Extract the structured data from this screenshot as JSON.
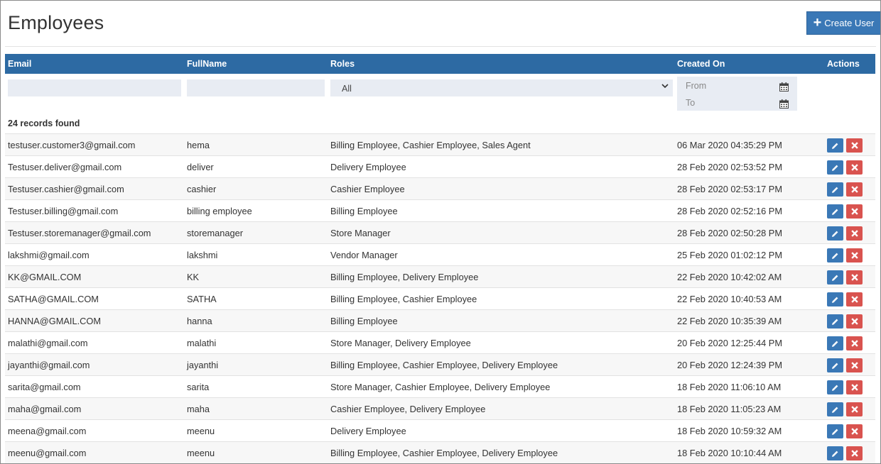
{
  "header": {
    "title": "Employees",
    "create_label": "Create User",
    "create_icon": "plus-icon"
  },
  "columns": {
    "email": "Email",
    "fullname": "FullName",
    "roles": "Roles",
    "created_on": "Created On",
    "actions": "Actions"
  },
  "filters": {
    "email_value": "",
    "fullname_value": "",
    "roles_selected": "All",
    "from_placeholder": "From",
    "to_placeholder": "To"
  },
  "records_found": "24 records found",
  "colors": {
    "header_bg": "#2d6aa3",
    "primary": "#3a78b6",
    "danger": "#d9534f",
    "filter_bg": "#e8ecf3"
  },
  "rows": [
    {
      "email": "testuser.customer3@gmail.com",
      "fullname": "hema",
      "roles": "Billing Employee, Cashier Employee, Sales Agent",
      "created_on": "06 Mar 2020 04:35:29 PM"
    },
    {
      "email": "Testuser.deliver@gmail.com",
      "fullname": "deliver",
      "roles": "Delivery Employee",
      "created_on": "28 Feb 2020 02:53:52 PM"
    },
    {
      "email": "Testuser.cashier@gmail.com",
      "fullname": "cashier",
      "roles": "Cashier Employee",
      "created_on": "28 Feb 2020 02:53:17 PM"
    },
    {
      "email": "Testuser.billing@gmail.com",
      "fullname": "billing employee",
      "roles": "Billing Employee",
      "created_on": "28 Feb 2020 02:52:16 PM"
    },
    {
      "email": "Testuser.storemanager@gmail.com",
      "fullname": "storemanager",
      "roles": "Store Manager",
      "created_on": "28 Feb 2020 02:50:28 PM"
    },
    {
      "email": "lakshmi@gmail.com",
      "fullname": "lakshmi",
      "roles": "Vendor Manager",
      "created_on": "25 Feb 2020 01:02:12 PM"
    },
    {
      "email": "KK@GMAIL.COM",
      "fullname": "KK",
      "roles": "Billing Employee, Delivery Employee",
      "created_on": "22 Feb 2020 10:42:02 AM"
    },
    {
      "email": "SATHA@GMAIL.COM",
      "fullname": "SATHA",
      "roles": "Billing Employee, Cashier Employee",
      "created_on": "22 Feb 2020 10:40:53 AM"
    },
    {
      "email": "HANNA@GMAIL.COM",
      "fullname": "hanna",
      "roles": "Billing Employee",
      "created_on": "22 Feb 2020 10:35:39 AM"
    },
    {
      "email": "malathi@gmail.com",
      "fullname": "malathi",
      "roles": "Store Manager, Delivery Employee",
      "created_on": "20 Feb 2020 12:25:44 PM"
    },
    {
      "email": "jayanthi@gmail.com",
      "fullname": "jayanthi",
      "roles": "Billing Employee, Cashier Employee, Delivery Employee",
      "created_on": "20 Feb 2020 12:24:39 PM"
    },
    {
      "email": "sarita@gmail.com",
      "fullname": "sarita",
      "roles": "Store Manager, Cashier Employee, Delivery Employee",
      "created_on": "18 Feb 2020 11:06:10 AM"
    },
    {
      "email": "maha@gmail.com",
      "fullname": "maha",
      "roles": "Cashier Employee, Delivery Employee",
      "created_on": "18 Feb 2020 11:05:23 AM"
    },
    {
      "email": "meena@gmail.com",
      "fullname": "meenu",
      "roles": "Delivery Employee",
      "created_on": "18 Feb 2020 10:59:32 AM"
    },
    {
      "email": "meenu@gmail.com",
      "fullname": "meenu",
      "roles": "Billing Employee, Cashier Employee, Delivery Employee",
      "created_on": "18 Feb 2020 10:10:44 AM"
    }
  ]
}
